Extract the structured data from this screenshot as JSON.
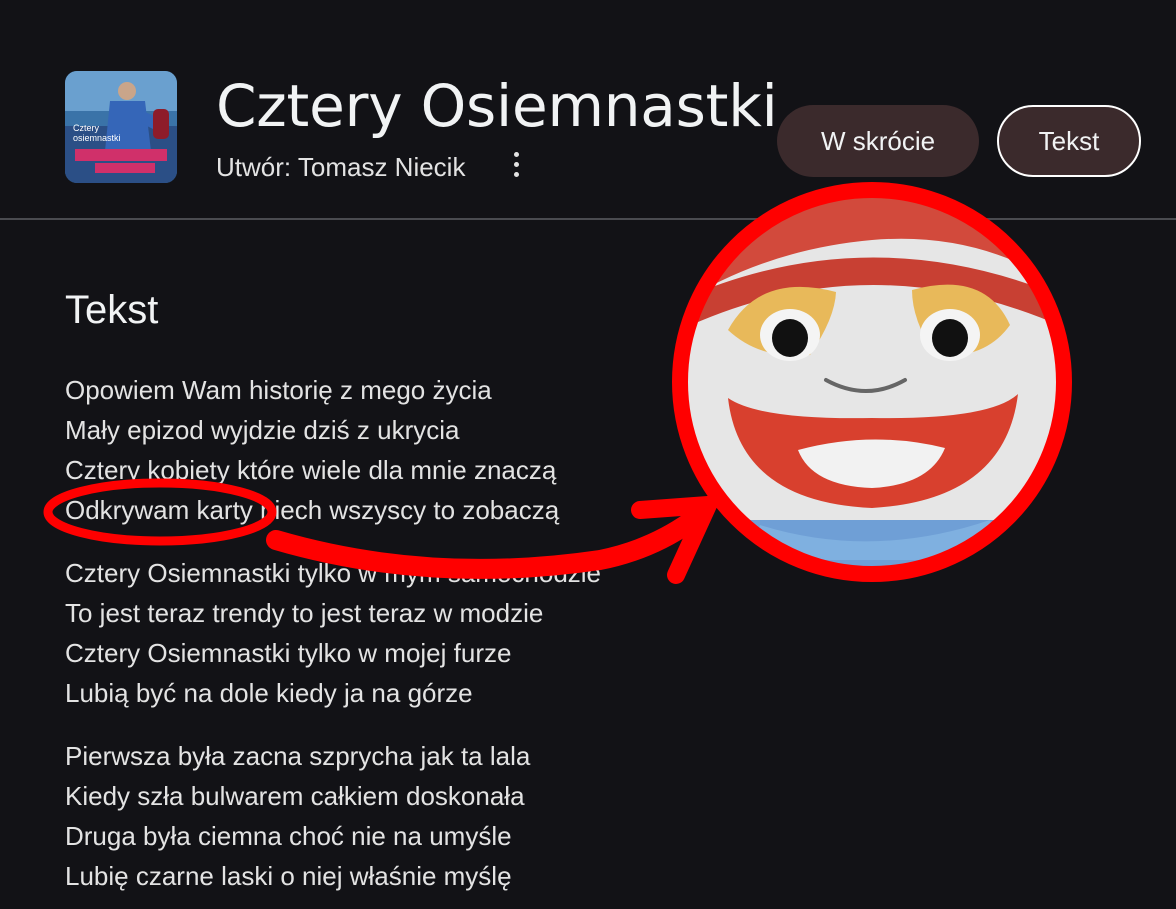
{
  "header": {
    "title": "Cztery Osiemnastki",
    "subtitle": "Utwór: Tomasz Niecik",
    "buttons": {
      "summary": "W skrócie",
      "lyrics": "Tekst"
    },
    "more_icon": "more-vert-icon"
  },
  "section": {
    "title": "Tekst"
  },
  "lyrics": [
    [
      "Opowiem Wam historię z mego życia",
      "Mały epizod wyjdzie dziś z ukrycia",
      "Cztery kobiety które wiele dla mnie znaczą",
      "Odkrywam karty niech wszyscy to zobaczą"
    ],
    [
      "Cztery Osiemnastki tylko w mym samochodzie",
      "To jest teraz trendy to jest teraz w modzie",
      "Cztery Osiemnastki tylko w mojej furze",
      "Lubią być na dole kiedy ja na górze"
    ],
    [
      "Pierwsza była zacna szprycha jak ta lala",
      "Kiedy szła bulwarem całkiem doskonała",
      "Druga była ciemna choć nie na umyśle",
      "Lubię czarne laski o niej właśnie myślę"
    ]
  ],
  "annotation": {
    "color": "#ff0000",
    "shapes": [
      "ellipse",
      "arrow",
      "circle"
    ],
    "zoom_subject": "plush-toy-face"
  },
  "colors": {
    "background": "#121216",
    "chip_bg": "#3b2a2c",
    "text": "#e3e3e3"
  }
}
